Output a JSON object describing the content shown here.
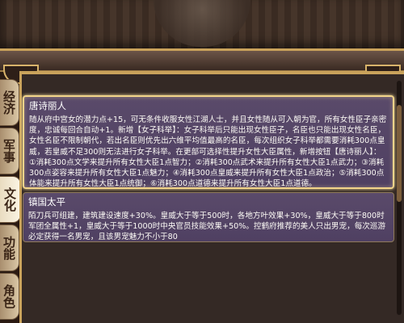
{
  "colors": {
    "card_bg": "#4f4062",
    "tab_bg": "#d9c7a5",
    "gold_border": "#c9a25b",
    "selection_glow": "#f2d48a"
  },
  "tabs": [
    {
      "label": "经济",
      "active": false
    },
    {
      "label": "军事",
      "active": false
    },
    {
      "label": "文化",
      "active": true
    },
    {
      "label": "功能",
      "active": false
    },
    {
      "label": "角色",
      "active": false
    }
  ],
  "cards": [
    {
      "title": "唐诗丽人",
      "body": "随从府中宫女的潜力点+15，可无条件收服女性江湖人士，并且女性随从可入朝为官，所有女性臣子亲密度，忠诚每回合自动+1。新增【女子科举】：女子科举后只能出现女性臣子，名臣也只能出现女性名臣，女性名臣不限制朝代，若出名臣则优先出六维平均值最高的名臣，每次组织女子科举都需要消耗300点皇威，若皇威不足300则无法进行女子科举。在更部可选择性提升女性大臣属性，新增按钮【唐诗丽人】：①消耗300点文学来提升所有女性大臣1点智力；②消耗300点武术来提升所有女性大臣1点武力；③消耗300点姿容来提升所有女性大臣1点魅力；④消耗300点皇威来提升所有女性大臣1点政治；⑤消耗300点体能来提升所有女性大臣1点统御；⑥消耗300点道德来提升所有女性大臣1点道德。",
      "selected": true
    },
    {
      "title": "镇国太平",
      "body": "陌刀兵可组建，建筑建设速度+30%。皇威大于等于500时，各地方叶效果+30%，皇威大于等于800时军团全属性+1，皇威大于等于1000时中央官员技能效果+50%。控鹤府推荐的美人只出男宠，每次巡游必定获得一名男宠，且该男宠魅力不小于80",
      "selected": false
    }
  ]
}
